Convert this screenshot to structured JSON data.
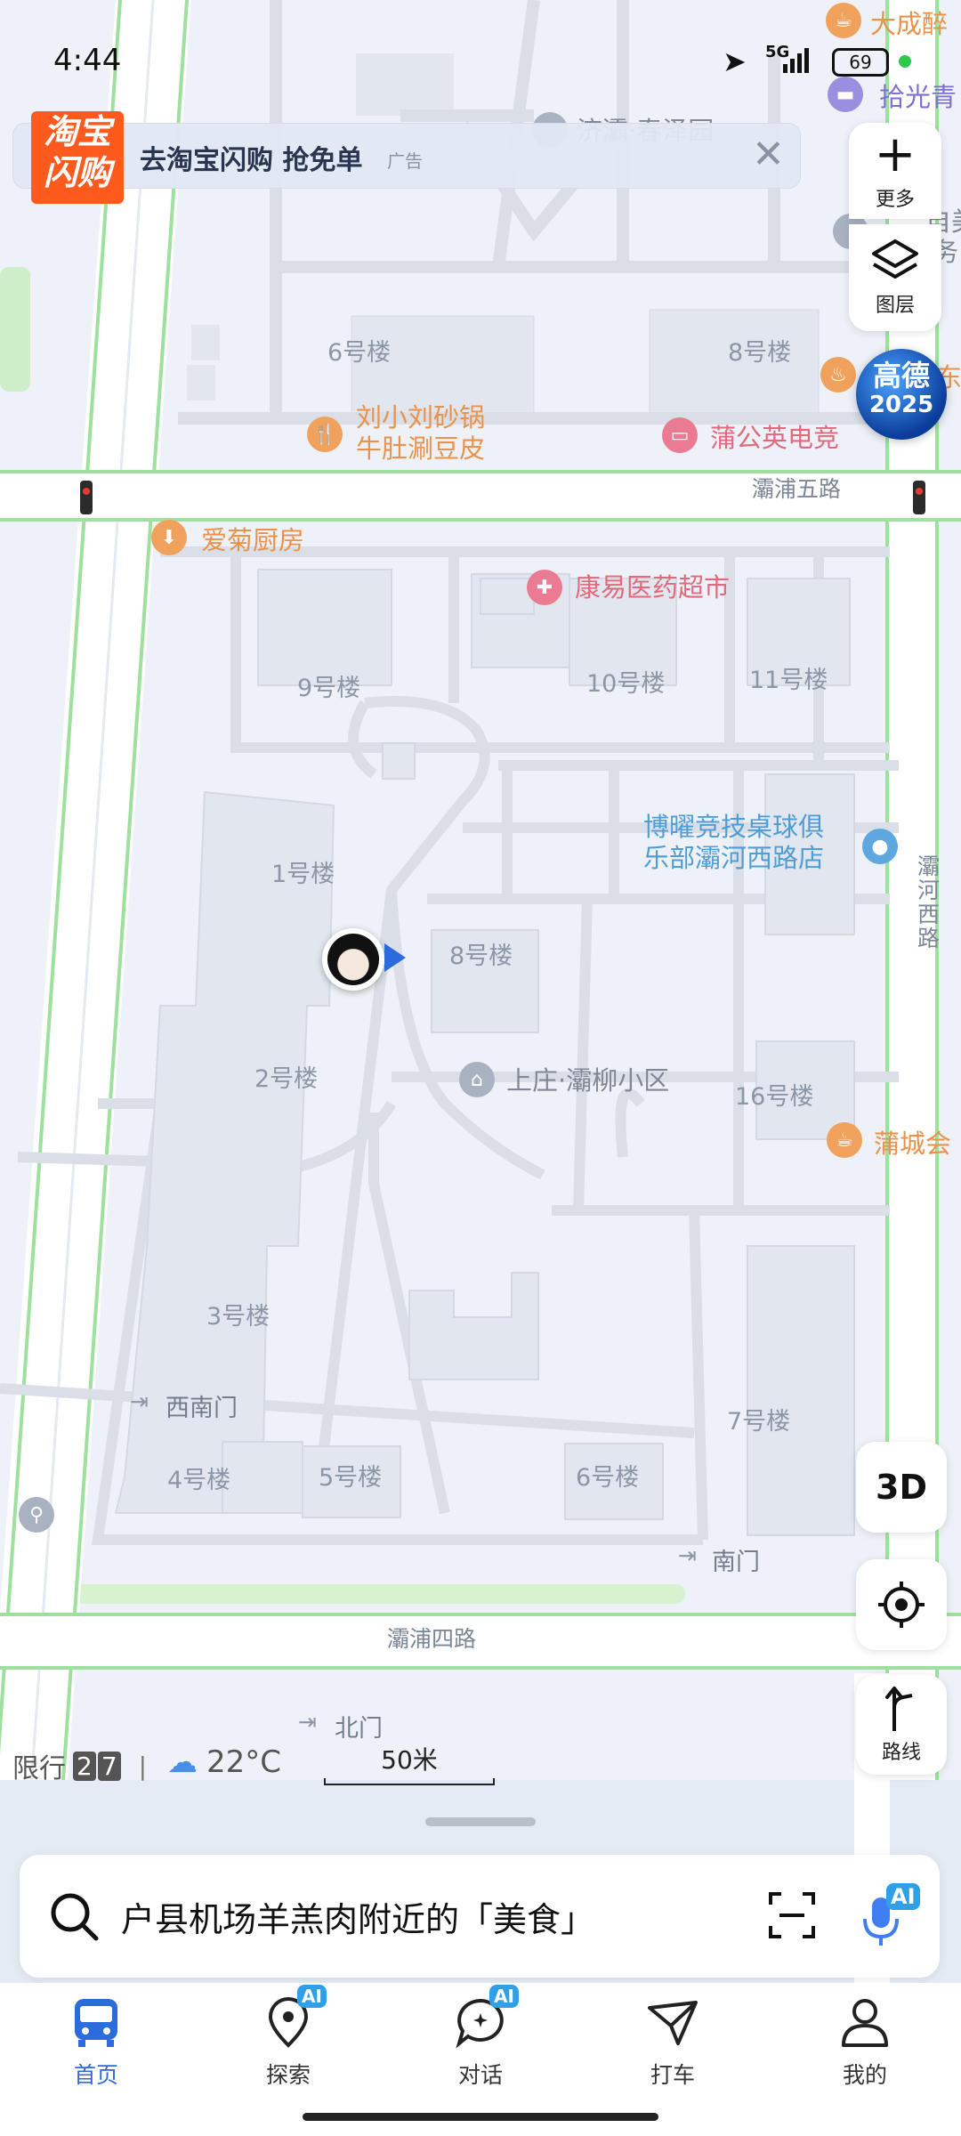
{
  "status_bar": {
    "time": "4:44",
    "network": "5G",
    "battery": "69"
  },
  "ad_banner": {
    "logo_line1": "淘宝",
    "logo_line2": "闪购",
    "text": "去淘宝闪购 抢免单",
    "tag": "广告"
  },
  "right_buttons": {
    "more_label": "更多",
    "layers_label": "图层",
    "gaode_line1": "高德",
    "gaode_line2": "2025",
    "three_d_label": "3D",
    "route_label": "路线"
  },
  "map": {
    "buildings": [
      "6号楼",
      "8号楼",
      "9号楼",
      "10号楼",
      "11号楼",
      "1号楼",
      "8号楼",
      "2号楼",
      "16号楼",
      "3号楼",
      "7号楼",
      "4号楼",
      "5号楼",
      "6号楼"
    ],
    "roads": [
      "灞浦五路",
      "灞浦四路",
      "灞河西路"
    ],
    "pois": {
      "top_right_1": "大成醉",
      "top_right_2": "拾光青",
      "top_obscured": "济灞·春泽园",
      "right_edge_1": "自美毅",
      "right_edge_2": "务",
      "right_edge_3": "东",
      "restaurant": "刘小刘砂锅\n牛肚涮豆皮",
      "electronics": "蒲公英电竞",
      "kitchen": "爱菊厨房",
      "pharmacy": "康易医药超市",
      "billiards": "博曜竞技桌球俱\n乐部灞河西路店",
      "community": "上庄·灞柳小区",
      "huicheng": "蒲城会",
      "gate_sw": "西南门",
      "gate_s": "南门",
      "gate_n": "北门"
    },
    "scale_label": "50米"
  },
  "info_bar": {
    "restriction_label": "限行",
    "restriction_d1": "2",
    "restriction_d2": "7",
    "separator": "|",
    "temperature": "22°C"
  },
  "search": {
    "placeholder": "户县机场羊羔肉附近的「美食」",
    "ai_badge": "AI"
  },
  "bottom_nav": [
    {
      "label": "首页",
      "icon": "bus-icon",
      "active": true
    },
    {
      "label": "探索",
      "icon": "explore-pin-icon",
      "ai": "AI"
    },
    {
      "label": "对话",
      "icon": "chat-bubble-icon",
      "ai": "AI"
    },
    {
      "label": "打车",
      "icon": "taxi-flag-icon"
    },
    {
      "label": "我的",
      "icon": "person-icon"
    }
  ],
  "colors": {
    "accent": "#2b6bdc",
    "map_bg": "#eef2f8",
    "building": "#e2e7ef",
    "road": "#ffffff",
    "green_edge": "#8fe095",
    "nav_active": "#2b6bdc"
  }
}
